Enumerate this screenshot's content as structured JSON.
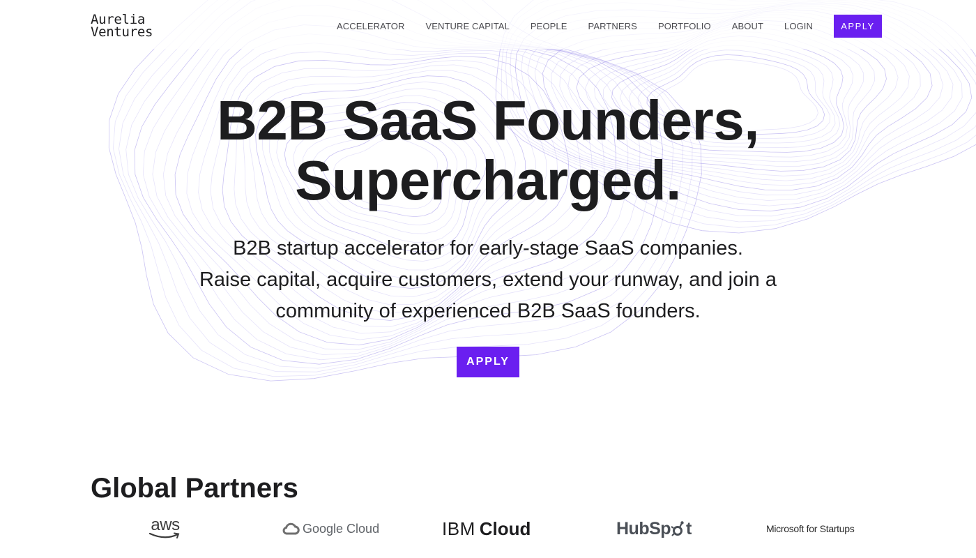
{
  "brand": {
    "logo_line1": "Aurelia",
    "logo_line2": "Ventures"
  },
  "nav": {
    "items": [
      {
        "label": "ACCELERATOR"
      },
      {
        "label": "VENTURE CAPITAL"
      },
      {
        "label": "PEOPLE"
      },
      {
        "label": "PARTNERS"
      },
      {
        "label": "PORTFOLIO"
      },
      {
        "label": "ABOUT"
      },
      {
        "label": "LOGIN"
      }
    ],
    "apply_label": "APPLY"
  },
  "hero": {
    "title_line1": "B2B SaaS Founders,",
    "title_line2": "Supercharged.",
    "subtitle_line1": "B2B startup accelerator for early-stage SaaS companies.",
    "subtitle_line2": "Raise capital, acquire customers, extend your runway, and join a",
    "subtitle_line3": "community of experienced B2B SaaS founders.",
    "apply_label": "APPLY"
  },
  "partners": {
    "title": "Global Partners",
    "logos": [
      {
        "name": "aws",
        "text": "aws",
        "icon": "amazon-smile-icon"
      },
      {
        "name": "google-cloud",
        "text": "Google Cloud",
        "icon": "cloud-icon"
      },
      {
        "name": "ibm-cloud",
        "text_a": "IBM",
        "text_b": "Cloud"
      },
      {
        "name": "hubspot",
        "text_a": "HubSp",
        "text_b": "t",
        "icon": "sprocket-icon"
      },
      {
        "name": "microsoft-for-startups",
        "text": "Microsoft for Startups"
      }
    ]
  },
  "colors": {
    "accent": "#6a1ff0",
    "text": "#1d1d1f",
    "nav_text": "#4a4a4f",
    "contour": "#8f7fe6"
  }
}
